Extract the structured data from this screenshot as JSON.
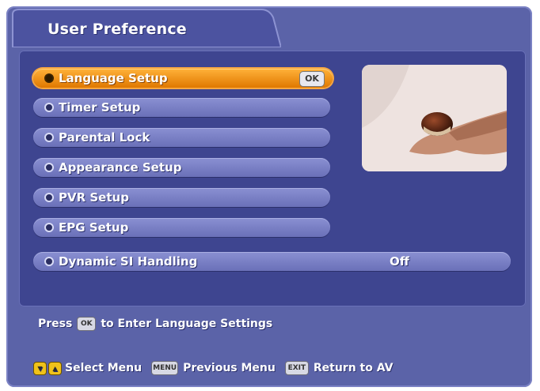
{
  "screen": {
    "title": "User Preference"
  },
  "menu": {
    "items": [
      {
        "label": "Language Setup",
        "badge": "OK"
      },
      {
        "label": "Timer Setup"
      },
      {
        "label": "Parental Lock"
      },
      {
        "label": "Appearance Setup"
      },
      {
        "label": "PVR Setup"
      },
      {
        "label": "EPG Setup"
      },
      {
        "label": "Dynamic SI Handling",
        "value": "Off"
      }
    ]
  },
  "help": {
    "prefix": "Press",
    "key": "OK",
    "suffix": "to Enter Language Settings"
  },
  "footer": {
    "select_label": "Select Menu",
    "menu_key": "MENU",
    "previous_label": "Previous Menu",
    "exit_key": "EXIT",
    "return_label": "Return to AV"
  },
  "colors": {
    "background": "#5b63a8",
    "panel": "#3e4590",
    "menu_item": "#7a80c6",
    "highlight": "#f08c10"
  },
  "icons": [
    "arrow-down-icon",
    "arrow-up-icon"
  ]
}
